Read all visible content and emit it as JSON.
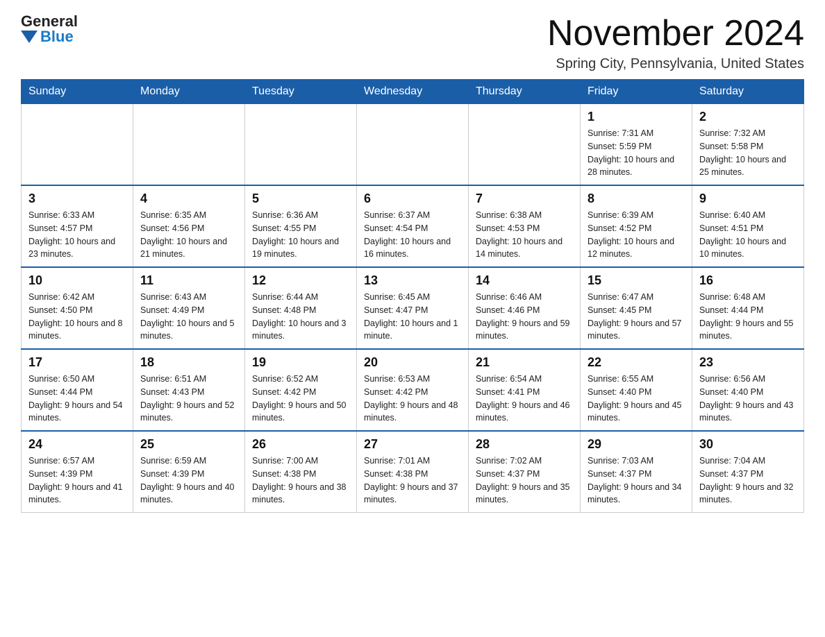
{
  "header": {
    "logo": {
      "general": "General",
      "blue": "Blue"
    },
    "title": "November 2024",
    "location": "Spring City, Pennsylvania, United States"
  },
  "weekdays": [
    "Sunday",
    "Monday",
    "Tuesday",
    "Wednesday",
    "Thursday",
    "Friday",
    "Saturday"
  ],
  "weeks": [
    [
      {
        "day": "",
        "info": ""
      },
      {
        "day": "",
        "info": ""
      },
      {
        "day": "",
        "info": ""
      },
      {
        "day": "",
        "info": ""
      },
      {
        "day": "",
        "info": ""
      },
      {
        "day": "1",
        "info": "Sunrise: 7:31 AM\nSunset: 5:59 PM\nDaylight: 10 hours and 28 minutes."
      },
      {
        "day": "2",
        "info": "Sunrise: 7:32 AM\nSunset: 5:58 PM\nDaylight: 10 hours and 25 minutes."
      }
    ],
    [
      {
        "day": "3",
        "info": "Sunrise: 6:33 AM\nSunset: 4:57 PM\nDaylight: 10 hours and 23 minutes."
      },
      {
        "day": "4",
        "info": "Sunrise: 6:35 AM\nSunset: 4:56 PM\nDaylight: 10 hours and 21 minutes."
      },
      {
        "day": "5",
        "info": "Sunrise: 6:36 AM\nSunset: 4:55 PM\nDaylight: 10 hours and 19 minutes."
      },
      {
        "day": "6",
        "info": "Sunrise: 6:37 AM\nSunset: 4:54 PM\nDaylight: 10 hours and 16 minutes."
      },
      {
        "day": "7",
        "info": "Sunrise: 6:38 AM\nSunset: 4:53 PM\nDaylight: 10 hours and 14 minutes."
      },
      {
        "day": "8",
        "info": "Sunrise: 6:39 AM\nSunset: 4:52 PM\nDaylight: 10 hours and 12 minutes."
      },
      {
        "day": "9",
        "info": "Sunrise: 6:40 AM\nSunset: 4:51 PM\nDaylight: 10 hours and 10 minutes."
      }
    ],
    [
      {
        "day": "10",
        "info": "Sunrise: 6:42 AM\nSunset: 4:50 PM\nDaylight: 10 hours and 8 minutes."
      },
      {
        "day": "11",
        "info": "Sunrise: 6:43 AM\nSunset: 4:49 PM\nDaylight: 10 hours and 5 minutes."
      },
      {
        "day": "12",
        "info": "Sunrise: 6:44 AM\nSunset: 4:48 PM\nDaylight: 10 hours and 3 minutes."
      },
      {
        "day": "13",
        "info": "Sunrise: 6:45 AM\nSunset: 4:47 PM\nDaylight: 10 hours and 1 minute."
      },
      {
        "day": "14",
        "info": "Sunrise: 6:46 AM\nSunset: 4:46 PM\nDaylight: 9 hours and 59 minutes."
      },
      {
        "day": "15",
        "info": "Sunrise: 6:47 AM\nSunset: 4:45 PM\nDaylight: 9 hours and 57 minutes."
      },
      {
        "day": "16",
        "info": "Sunrise: 6:48 AM\nSunset: 4:44 PM\nDaylight: 9 hours and 55 minutes."
      }
    ],
    [
      {
        "day": "17",
        "info": "Sunrise: 6:50 AM\nSunset: 4:44 PM\nDaylight: 9 hours and 54 minutes."
      },
      {
        "day": "18",
        "info": "Sunrise: 6:51 AM\nSunset: 4:43 PM\nDaylight: 9 hours and 52 minutes."
      },
      {
        "day": "19",
        "info": "Sunrise: 6:52 AM\nSunset: 4:42 PM\nDaylight: 9 hours and 50 minutes."
      },
      {
        "day": "20",
        "info": "Sunrise: 6:53 AM\nSunset: 4:42 PM\nDaylight: 9 hours and 48 minutes."
      },
      {
        "day": "21",
        "info": "Sunrise: 6:54 AM\nSunset: 4:41 PM\nDaylight: 9 hours and 46 minutes."
      },
      {
        "day": "22",
        "info": "Sunrise: 6:55 AM\nSunset: 4:40 PM\nDaylight: 9 hours and 45 minutes."
      },
      {
        "day": "23",
        "info": "Sunrise: 6:56 AM\nSunset: 4:40 PM\nDaylight: 9 hours and 43 minutes."
      }
    ],
    [
      {
        "day": "24",
        "info": "Sunrise: 6:57 AM\nSunset: 4:39 PM\nDaylight: 9 hours and 41 minutes."
      },
      {
        "day": "25",
        "info": "Sunrise: 6:59 AM\nSunset: 4:39 PM\nDaylight: 9 hours and 40 minutes."
      },
      {
        "day": "26",
        "info": "Sunrise: 7:00 AM\nSunset: 4:38 PM\nDaylight: 9 hours and 38 minutes."
      },
      {
        "day": "27",
        "info": "Sunrise: 7:01 AM\nSunset: 4:38 PM\nDaylight: 9 hours and 37 minutes."
      },
      {
        "day": "28",
        "info": "Sunrise: 7:02 AM\nSunset: 4:37 PM\nDaylight: 9 hours and 35 minutes."
      },
      {
        "day": "29",
        "info": "Sunrise: 7:03 AM\nSunset: 4:37 PM\nDaylight: 9 hours and 34 minutes."
      },
      {
        "day": "30",
        "info": "Sunrise: 7:04 AM\nSunset: 4:37 PM\nDaylight: 9 hours and 32 minutes."
      }
    ]
  ]
}
